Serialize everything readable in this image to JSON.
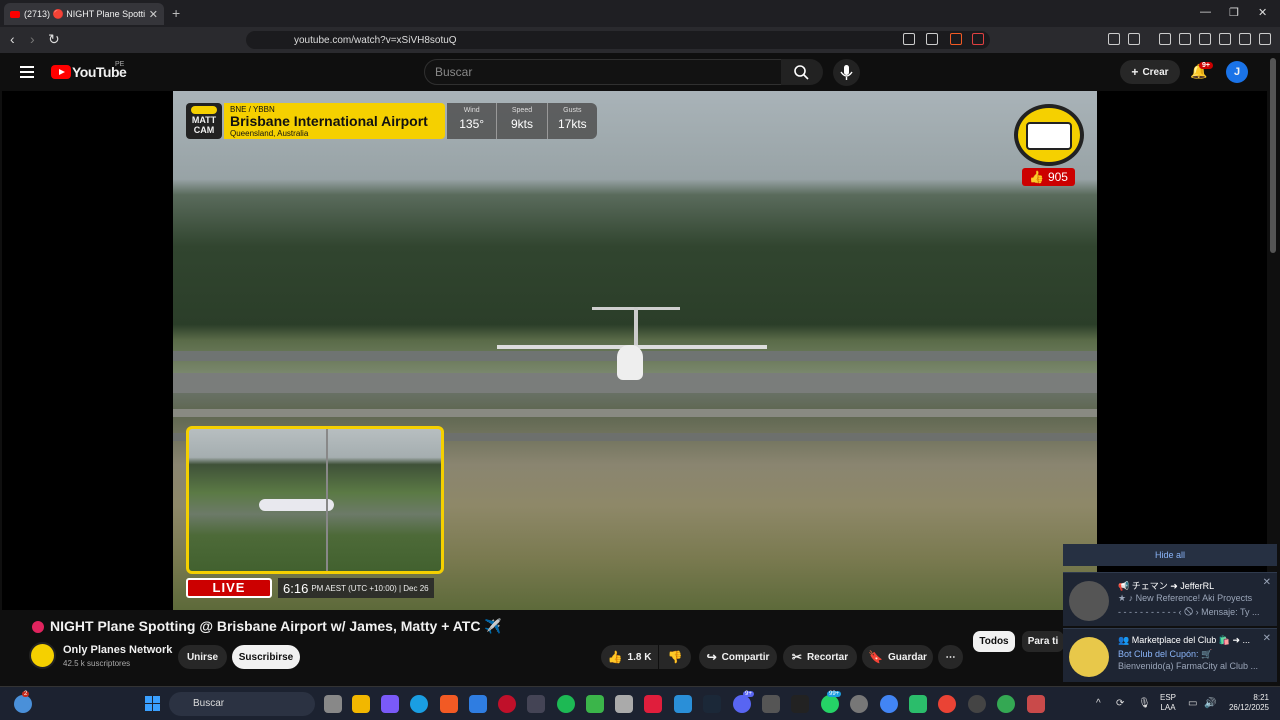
{
  "browser": {
    "tab_title": "(2713) 🔴 NIGHT Plane Spotti",
    "url": "youtube.com/watch?v=xSiVH8sotuQ"
  },
  "youtube": {
    "logo_text": "YouTube",
    "region": "PE",
    "search_placeholder": "Buscar",
    "create_label": "Crear",
    "notif_count": "9+",
    "avatar_letter": "J"
  },
  "overlay": {
    "cam_brand": "MATT CAM",
    "airport_code": "BNE / YBBN",
    "airport_name": "Brisbane International Airport",
    "airport_location": "Queensland, Australia",
    "weather": [
      {
        "label": "Wind",
        "value": "135°"
      },
      {
        "label": "Speed",
        "value": "9kts"
      },
      {
        "label": "Gusts",
        "value": "17kts"
      }
    ],
    "likes": "905",
    "live_label": "LIVE",
    "time": "6:16",
    "time_suffix": "PM AEST (UTC +10:00) | Dec 26"
  },
  "video": {
    "title": "NIGHT Plane Spotting @ Brisbane Airport w/ James, Matty + ATC ✈️",
    "channel_name": "Only Planes Network",
    "subscribers": "42.5 k suscriptores",
    "join_label": "Unirse",
    "subscribe_label": "Suscribirse",
    "like_count": "1.8 K",
    "share_label": "Compartir",
    "clip_label": "Recortar",
    "save_label": "Guardar"
  },
  "chips": [
    "Todos",
    "Para ti"
  ],
  "notifications": {
    "hide_all": "Hide all",
    "items": [
      {
        "title": "📢 チェマン ➜ JefferRL",
        "line1": "★ ♪ New Reference! Aki Proyects",
        "line2": "- - - - - - - - - - - ‹ 🛇 › Mensaje: Ty ..."
      },
      {
        "title": "👥 Marketplace del Club 🛍️ ➜ ...",
        "line1": "Bot Club del Cupón: 🛒",
        "line2": "Bienvenido(a) FarmaCity al Club ..."
      }
    ]
  },
  "taskbar": {
    "search_placeholder": "Buscar",
    "weather_badge": "2",
    "discord_badge": "9+",
    "whatsapp_badge": "99+",
    "lang_top": "ESP",
    "lang_bottom": "LAA",
    "time": "8:21",
    "date": "26/12/2025"
  }
}
